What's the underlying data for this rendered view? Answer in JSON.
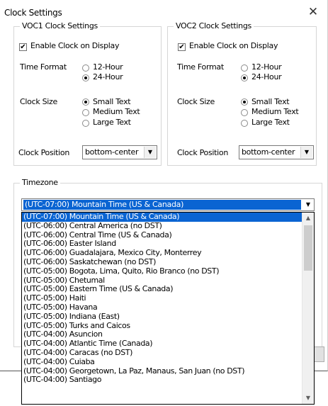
{
  "window": {
    "title": "Clock Settings",
    "close_glyph": "✕"
  },
  "voc1": {
    "legend": "VOC1 Clock Settings",
    "enable_label": "Enable Clock on Display",
    "enable_checked": true,
    "time_format_label": "Time Format",
    "time_format_options": [
      "12-Hour",
      "24-Hour"
    ],
    "time_format_selected": "24-Hour",
    "clock_size_label": "Clock Size",
    "clock_size_options": [
      "Small Text",
      "Medium Text",
      "Large Text"
    ],
    "clock_size_selected": "Small Text",
    "clock_position_label": "Clock Position",
    "clock_position_value": "bottom-center"
  },
  "voc2": {
    "legend": "VOC2 Clock Settings",
    "enable_label": "Enable Clock on Display",
    "enable_checked": true,
    "time_format_label": "Time Format",
    "time_format_options": [
      "12-Hour",
      "24-Hour"
    ],
    "time_format_selected": "24-Hour",
    "clock_size_label": "Clock Size",
    "clock_size_options": [
      "Small Text",
      "Medium Text",
      "Large Text"
    ],
    "clock_size_selected": "Small Text",
    "clock_position_label": "Clock Position",
    "clock_position_value": "bottom-center"
  },
  "timezone": {
    "legend": "Timezone",
    "selected": "(UTC-07:00) Mountain Time (US & Canada)",
    "options": [
      "(UTC-07:00) Mountain Time (US & Canada)",
      "(UTC-06:00) Central America   (no DST)",
      "(UTC-06:00) Central Time (US & Canada)",
      "(UTC-06:00) Easter Island",
      "(UTC-06:00) Guadalajara, Mexico City, Monterrey",
      "(UTC-06:00) Saskatchewan   (no DST)",
      "(UTC-05:00) Bogota, Lima, Quito, Rio Branco   (no DST)",
      "(UTC-05:00) Chetumal",
      "(UTC-05:00) Eastern Time (US & Canada)",
      "(UTC-05:00) Haiti",
      "(UTC-05:00) Havana",
      "(UTC-05:00) Indiana (East)",
      "(UTC-05:00) Turks and Caicos",
      "(UTC-04:00) Asuncion",
      "(UTC-04:00) Atlantic Time (Canada)",
      "(UTC-04:00) Caracas   (no DST)",
      "(UTC-04:00) Cuiaba",
      "(UTC-04:00) Georgetown, La Paz, Manaus, San Juan   (no DST)",
      "(UTC-04:00) Santiago"
    ],
    "highlighted_index": 0,
    "scroll_fraction": 0.0
  },
  "icons": {
    "checkmark": "✔",
    "dropdown_arrow": "▼",
    "scroll_up": "▲",
    "scroll_down": "▼"
  },
  "colors": {
    "selection": "#0a64d2",
    "group_border": "#d6d6d6"
  }
}
